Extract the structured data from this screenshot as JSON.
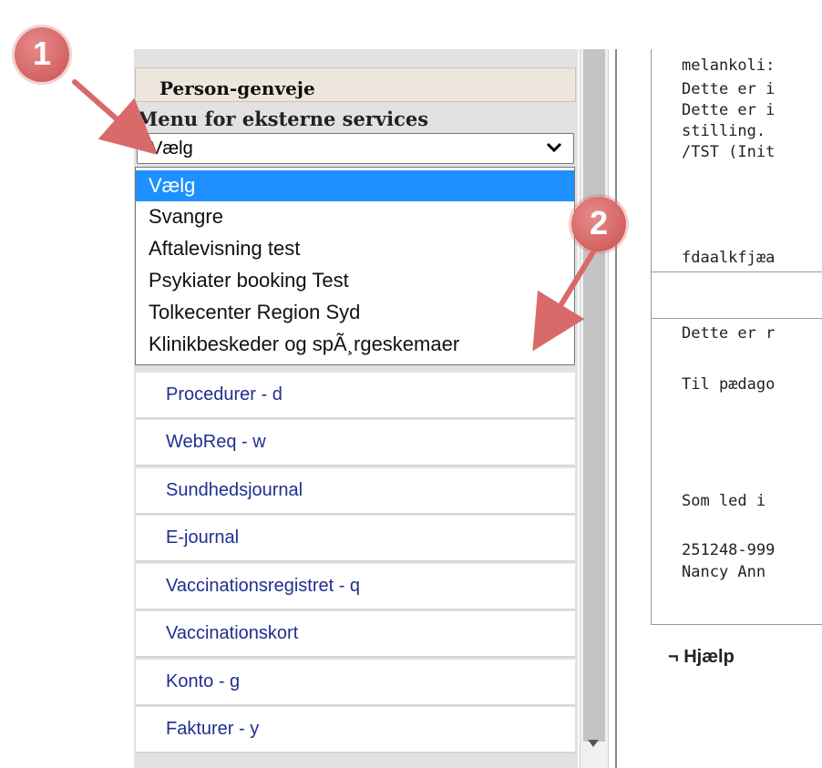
{
  "sidebar": {
    "header": "Person-genveje",
    "menu_label": "Menu for eksterne services",
    "select_value": "Vælg",
    "dropdown_options": [
      "Vælg",
      "Svangre",
      "Aftalevisning test",
      "Psykiater booking Test",
      "Tolkecenter Region Syd",
      "Klinikbeskeder og spÃ¸rgeskemaer"
    ],
    "nav_items": [
      "Procedurer - d",
      "WebReq - w",
      "Sundhedsjournal",
      "E-journal",
      "Vaccinationsregistret - q",
      "Vaccinationskort",
      "Konto - g",
      "Fakturer - y"
    ]
  },
  "content": {
    "lines_top": [
      "melankoli:",
      "Dette er i",
      "Dette er i",
      "stilling.",
      "/TST (Init"
    ],
    "line_mid": "fdaalkfjæa",
    "lines_bottom": [
      "Dette er r",
      "Til pædago",
      "Som led i",
      "251248-999",
      "Nancy Ann"
    ],
    "help_label": "¬ Hjælp"
  },
  "annotations": {
    "badge_1": "1",
    "badge_2": "2",
    "badge_color": "#d06464"
  },
  "colors": {
    "selected_option": "#1e90ff",
    "nav_link": "#1f2f8f",
    "header_bg": "#ece6dc"
  }
}
